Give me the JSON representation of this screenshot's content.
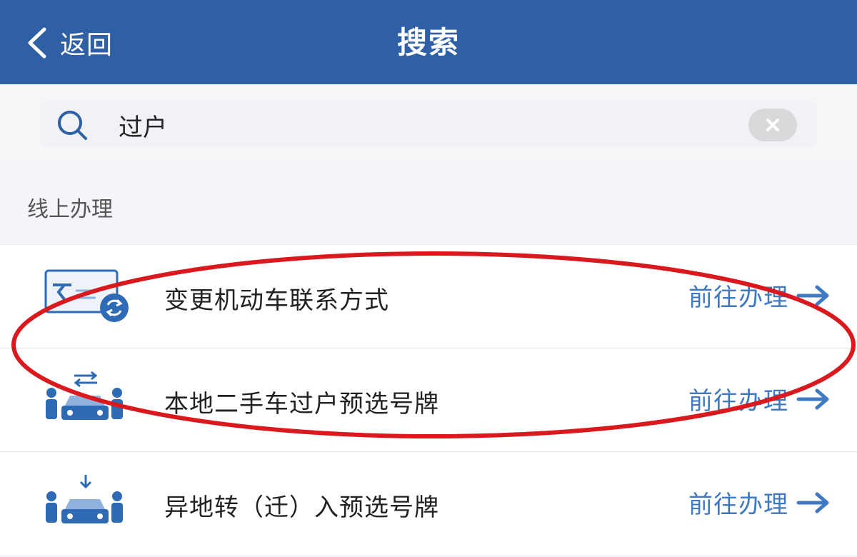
{
  "header": {
    "back_label": "返回",
    "title": "搜索"
  },
  "search": {
    "value": "过户",
    "placeholder": ""
  },
  "section": {
    "label": "线上办理"
  },
  "items": [
    {
      "label": "变更机动车联系方式",
      "action": "前往办理",
      "icon": "card-refresh-icon"
    },
    {
      "label": "本地二手车过户预选号牌",
      "action": "前往办理",
      "icon": "car-transfer-icon"
    },
    {
      "label": "异地转（迁）入预选号牌",
      "action": "前往办理",
      "icon": "car-import-icon"
    }
  ],
  "colors": {
    "header_bg": "#2f5fa4",
    "action_text": "#3f79c2",
    "annotation": "#d9191d"
  }
}
